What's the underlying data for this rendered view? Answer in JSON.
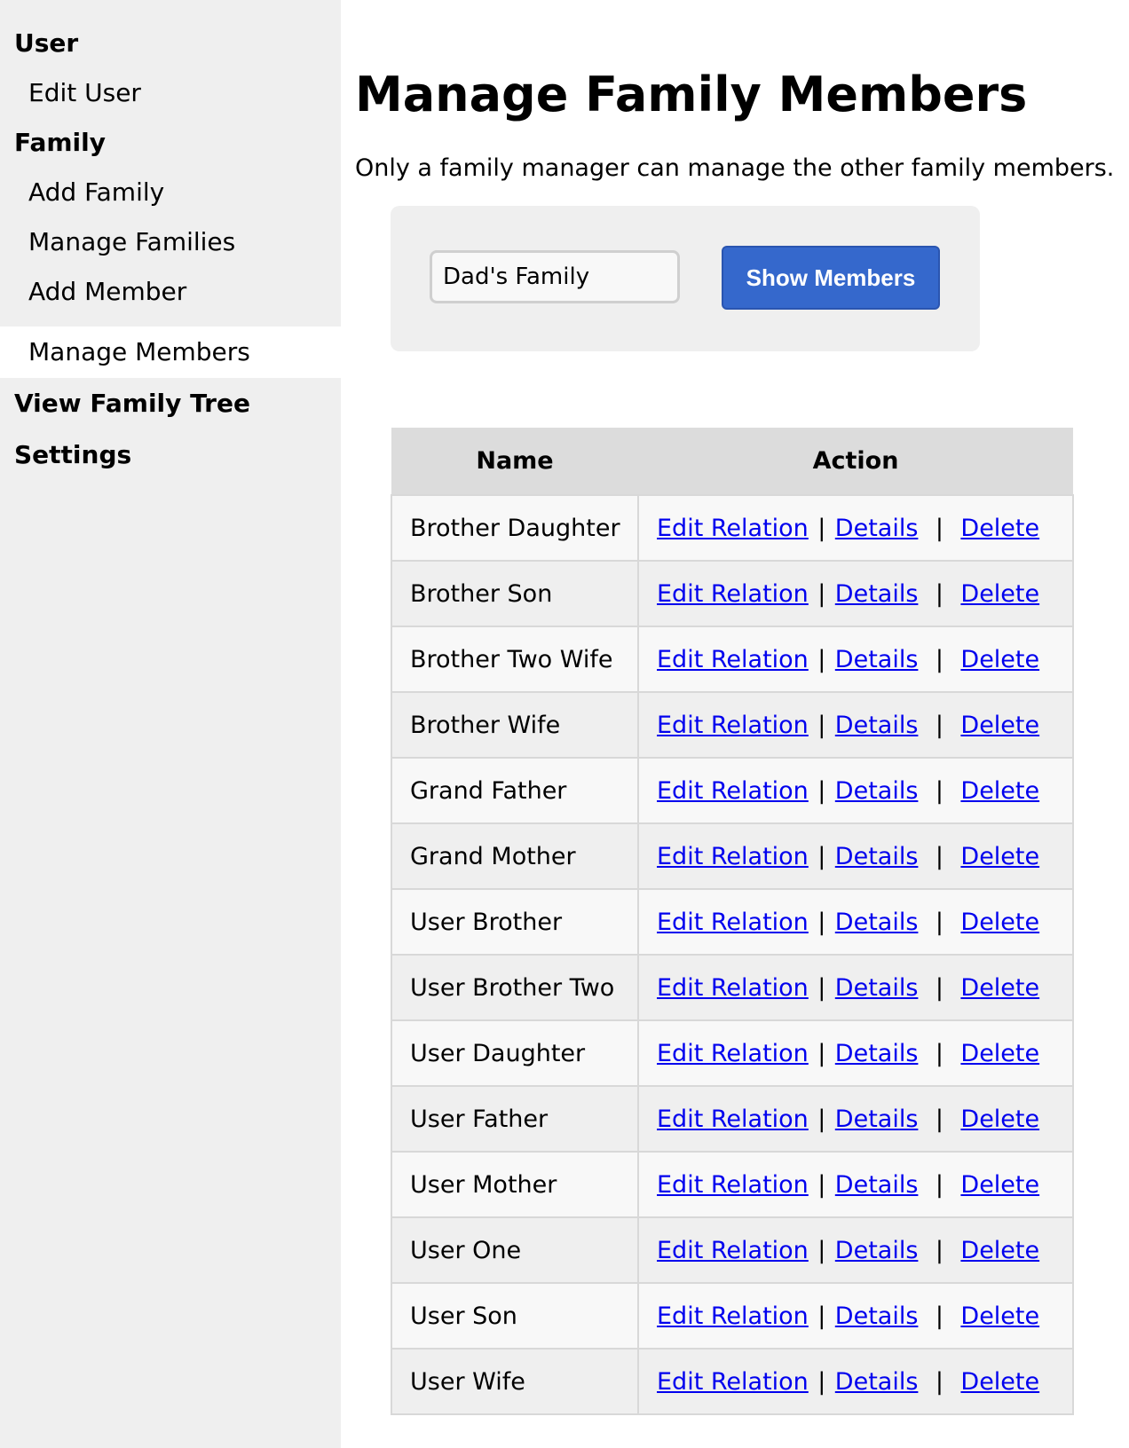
{
  "sidebar": {
    "user_heading": "User",
    "edit_user": "Edit User",
    "family_heading": "Family",
    "add_family": "Add Family",
    "manage_families": "Manage Families",
    "add_member": "Add Member",
    "manage_members": "Manage Members",
    "view_family_tree": "View Family Tree",
    "settings": "Settings"
  },
  "main": {
    "title": "Manage Family Members",
    "intro": "Only a family manager can manage the other family members.",
    "family_select_value": "Dad's Family",
    "show_members_label": "Show Members"
  },
  "table": {
    "headers": {
      "name": "Name",
      "action": "Action"
    },
    "actions": {
      "edit": "Edit Relation",
      "details": "Details",
      "delete": "Delete",
      "separator": "|"
    },
    "rows": [
      "Brother Daughter",
      "Brother Son",
      "Brother Two Wife",
      "Brother Wife",
      "Grand Father",
      "Grand Mother",
      "User Brother",
      "User Brother Two",
      "User Daughter",
      "User Father",
      "User Mother",
      "User One",
      "User Son",
      "User Wife"
    ]
  },
  "colors": {
    "sidebar_bg": "#efefef",
    "button_bg": "#3568cc",
    "link": "#0000ee",
    "header_bg": "#dcdcdc"
  }
}
